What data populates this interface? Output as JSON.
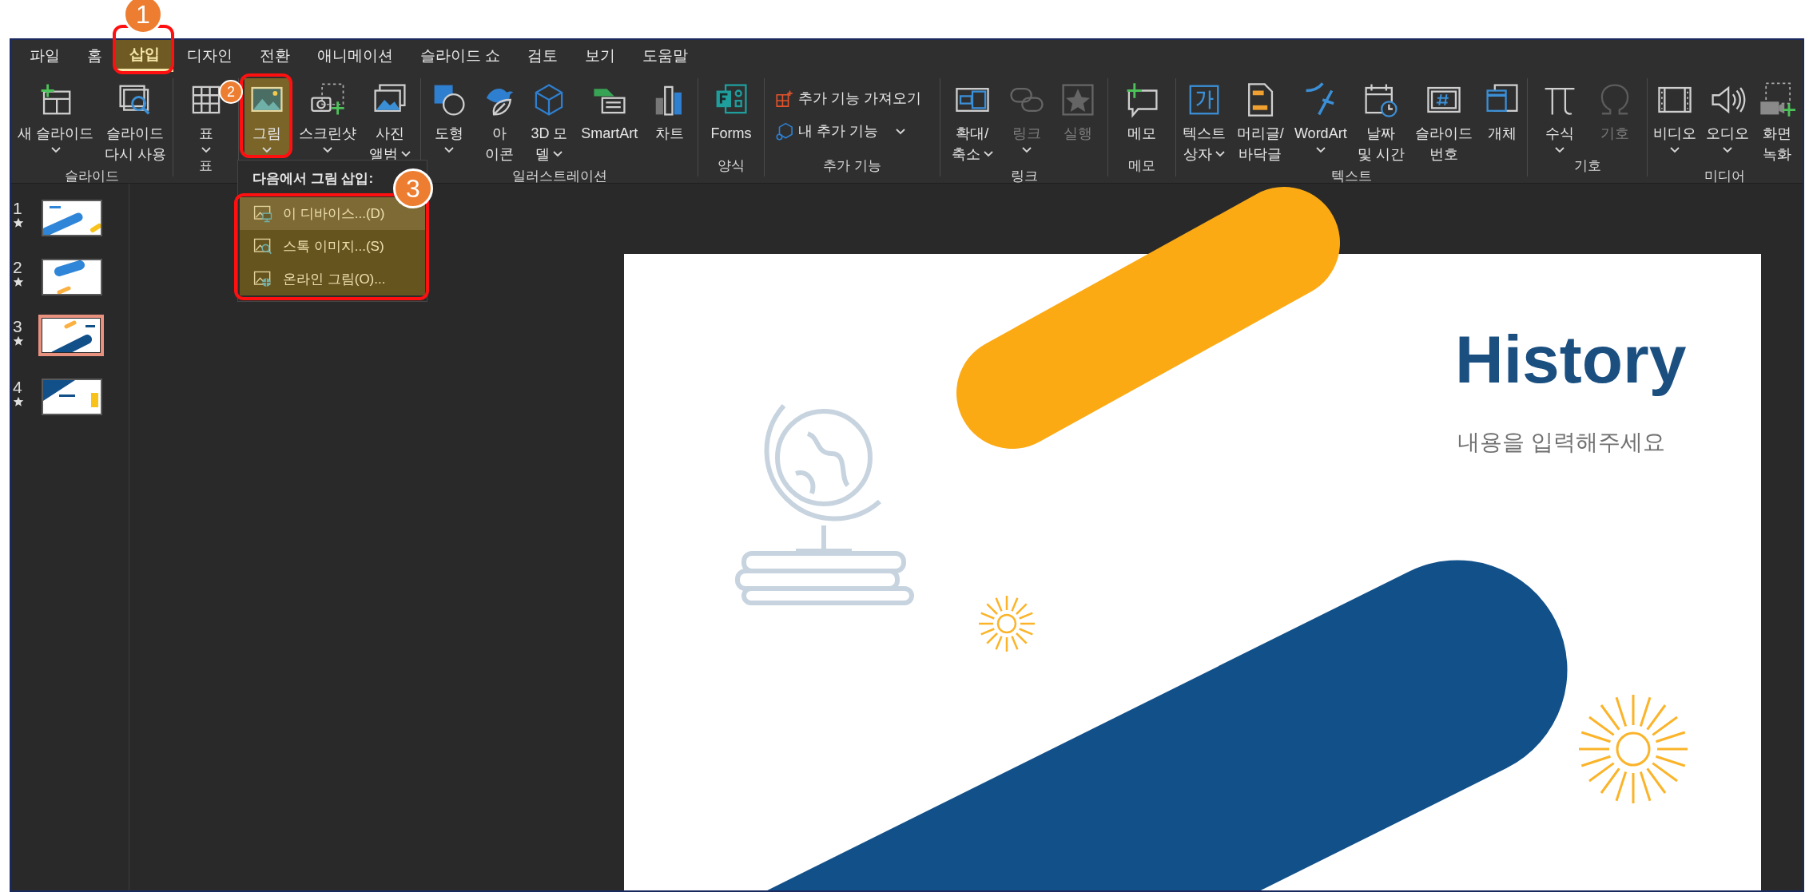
{
  "tabs": [
    {
      "label": "파일",
      "selected": false
    },
    {
      "label": "홈",
      "selected": false
    },
    {
      "label": "삽입",
      "selected": true
    },
    {
      "label": "디자인",
      "selected": false
    },
    {
      "label": "전환",
      "selected": false
    },
    {
      "label": "애니메이션",
      "selected": false
    },
    {
      "label": "슬라이드 쇼",
      "selected": false
    },
    {
      "label": "검토",
      "selected": false
    },
    {
      "label": "보기",
      "selected": false
    },
    {
      "label": "도움말",
      "selected": false
    }
  ],
  "ribbon_groups": [
    {
      "label": "슬라이드",
      "buttons": [
        {
          "kind": "large",
          "lines": [
            "새 슬라이드"
          ],
          "caret": true,
          "disabled": false,
          "selected": false
        },
        {
          "kind": "large",
          "lines": [
            "슬라이드",
            "다시 사용"
          ],
          "caret": false,
          "disabled": false,
          "selected": false
        }
      ]
    },
    {
      "label": "표",
      "buttons": [
        {
          "kind": "large",
          "lines": [
            "표"
          ],
          "caret": true,
          "disabled": false,
          "selected": false
        }
      ]
    },
    {
      "buttons": [
        {
          "kind": "large",
          "lines": [
            "그림"
          ],
          "caret": true,
          "disabled": false,
          "selected": true
        },
        {
          "kind": "large",
          "lines": [
            "스크린샷"
          ],
          "caret": true,
          "disabled": false,
          "selected": false
        },
        {
          "kind": "large",
          "lines": [
            "사진",
            "앨범"
          ],
          "caret": true,
          "disabled": false,
          "selected": false
        }
      ]
    },
    {
      "label": "일러스트레이션",
      "buttons": [
        {
          "kind": "large",
          "lines": [
            "도형"
          ],
          "caret": true,
          "disabled": false,
          "selected": false
        },
        {
          "kind": "large",
          "lines": [
            "아",
            "이콘"
          ],
          "caret": false,
          "disabled": false,
          "selected": false
        },
        {
          "kind": "large",
          "lines": [
            "3D 모",
            "델"
          ],
          "caret": true,
          "disabled": false,
          "selected": false
        },
        {
          "kind": "large",
          "lines": [
            "SmartArt"
          ],
          "caret": false,
          "disabled": false,
          "selected": false
        },
        {
          "kind": "large",
          "lines": [
            "차트"
          ],
          "caret": false,
          "disabled": false,
          "selected": false
        }
      ]
    },
    {
      "label": "양식",
      "buttons": [
        {
          "kind": "large",
          "lines": [
            "Forms"
          ],
          "caret": false,
          "disabled": false,
          "selected": false
        }
      ]
    },
    {
      "label": "추가 기능",
      "buttons": [
        {
          "kind": "small",
          "lines": [
            "추가 기능 가져오기"
          ],
          "caret": false,
          "disabled": false,
          "selected": false
        },
        {
          "kind": "small",
          "lines": [
            "내 추가 기능"
          ],
          "caret": true,
          "disabled": false,
          "selected": false
        }
      ]
    },
    {
      "label": "링크",
      "buttons": [
        {
          "kind": "large",
          "lines": [
            "확대/",
            "축소"
          ],
          "caret": true,
          "disabled": false,
          "selected": false
        },
        {
          "kind": "large",
          "lines": [
            "링크"
          ],
          "caret": true,
          "disabled": true,
          "selected": false
        },
        {
          "kind": "large",
          "lines": [
            "실행"
          ],
          "caret": false,
          "disabled": true,
          "selected": false
        }
      ]
    },
    {
      "label": "메모",
      "buttons": [
        {
          "kind": "large",
          "lines": [
            "메모"
          ],
          "caret": false,
          "disabled": false,
          "selected": false
        }
      ]
    },
    {
      "label": "텍스트",
      "buttons": [
        {
          "kind": "large",
          "lines": [
            "텍스트",
            "상자"
          ],
          "caret": true,
          "disabled": false,
          "selected": false
        },
        {
          "kind": "large",
          "lines": [
            "머리글/",
            "바닥글"
          ],
          "caret": false,
          "disabled": false,
          "selected": false
        },
        {
          "kind": "large",
          "lines": [
            "WordArt"
          ],
          "caret": true,
          "disabled": false,
          "selected": false
        },
        {
          "kind": "large",
          "lines": [
            "날짜",
            "및 시간"
          ],
          "caret": false,
          "disabled": false,
          "selected": false
        },
        {
          "kind": "large",
          "lines": [
            "슬라이드",
            "번호"
          ],
          "caret": false,
          "disabled": false,
          "selected": false
        },
        {
          "kind": "large",
          "lines": [
            "개체"
          ],
          "caret": false,
          "disabled": false,
          "selected": false
        }
      ]
    },
    {
      "label": "기호",
      "buttons": [
        {
          "kind": "large",
          "lines": [
            "수식"
          ],
          "caret": true,
          "disabled": false,
          "selected": false
        },
        {
          "kind": "large",
          "lines": [
            "기호"
          ],
          "caret": false,
          "disabled": true,
          "selected": false
        }
      ]
    },
    {
      "label": "미디어",
      "buttons": [
        {
          "kind": "large",
          "lines": [
            "비디오"
          ],
          "caret": true,
          "disabled": false,
          "selected": false
        },
        {
          "kind": "large",
          "lines": [
            "오디오"
          ],
          "caret": true,
          "disabled": false,
          "selected": false
        },
        {
          "kind": "large",
          "lines": [
            "화면",
            "녹화"
          ],
          "caret": false,
          "disabled": false,
          "selected": false
        }
      ]
    }
  ],
  "picture_menu": {
    "heading": "다음에서 그림 삽입:",
    "items": [
      {
        "label": "이 디바이스...(D)",
        "selected": true
      },
      {
        "label": "스톡 이미지...(S)",
        "selected": false
      },
      {
        "label": "온라인 그림(O)...",
        "selected": false
      }
    ]
  },
  "slides": [
    {
      "number": "1",
      "selected": false
    },
    {
      "number": "2",
      "selected": false
    },
    {
      "number": "3",
      "selected": true
    },
    {
      "number": "4",
      "selected": false
    }
  ],
  "slide": {
    "title": "History",
    "subtitle": "내용을 입력해주세요"
  },
  "callouts": [
    {
      "number": "1"
    },
    {
      "number": "2"
    },
    {
      "number": "3"
    }
  ]
}
